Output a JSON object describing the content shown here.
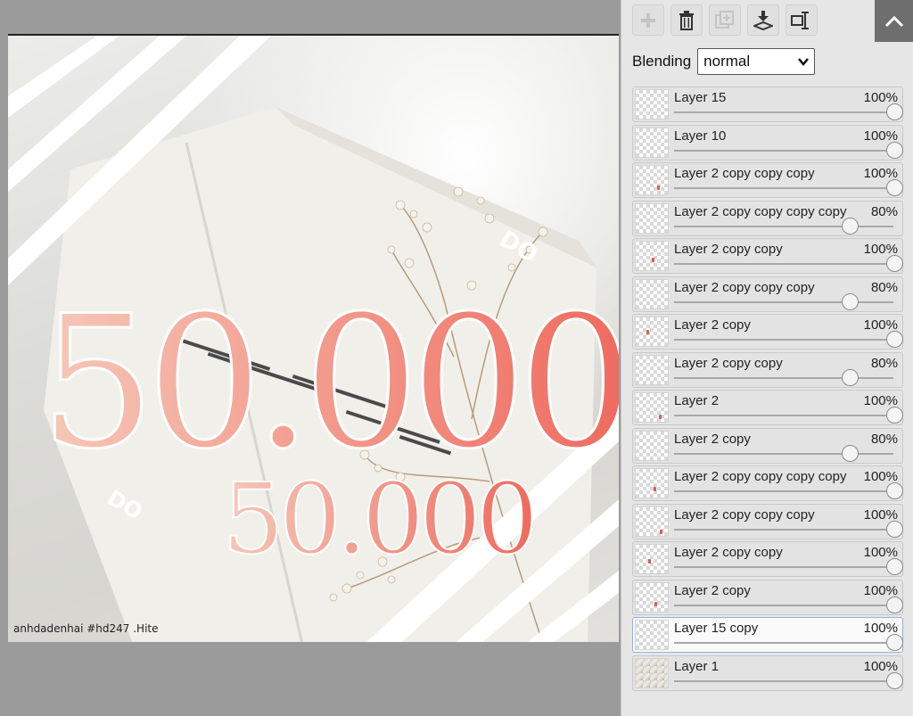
{
  "canvas": {
    "watermark": "anhdadenhai #hd247 .Hite",
    "big_number": "50.000",
    "small_number": "50.000",
    "sticker_text": "DO"
  },
  "toolbar": {
    "buttons": [
      {
        "name": "add-layer-button",
        "icon": "plus-icon"
      },
      {
        "name": "delete-layer-button",
        "icon": "trash-icon"
      },
      {
        "name": "duplicate-layer-button",
        "icon": "duplicate-icon"
      },
      {
        "name": "merge-down-button",
        "icon": "merge-down-icon"
      },
      {
        "name": "layer-properties-button",
        "icon": "properties-icon"
      }
    ],
    "collapse_icon": "chevron-up-icon"
  },
  "blending": {
    "label": "Blending",
    "value": "normal"
  },
  "layers": [
    {
      "name": "Layer 15",
      "opacity": "100%",
      "opacity_value": 1.0,
      "thumb": "blank"
    },
    {
      "name": "Layer 10",
      "opacity": "100%",
      "opacity_value": 1.0,
      "thumb": "blank"
    },
    {
      "name": "Layer 2 copy copy copy",
      "opacity": "100%",
      "opacity_value": 1.0,
      "thumb": "dot"
    },
    {
      "name": "Layer 2 copy copy copy copy",
      "opacity": "80%",
      "opacity_value": 0.8,
      "thumb": "blank"
    },
    {
      "name": "Layer 2 copy copy",
      "opacity": "100%",
      "opacity_value": 1.0,
      "thumb": "dot"
    },
    {
      "name": "Layer 2 copy copy copy",
      "opacity": "80%",
      "opacity_value": 0.8,
      "thumb": "blank"
    },
    {
      "name": "Layer 2 copy",
      "opacity": "100%",
      "opacity_value": 1.0,
      "thumb": "dot"
    },
    {
      "name": "Layer 2 copy copy",
      "opacity": "80%",
      "opacity_value": 0.8,
      "thumb": "blank"
    },
    {
      "name": "Layer 2",
      "opacity": "100%",
      "opacity_value": 1.0,
      "thumb": "dot"
    },
    {
      "name": "Layer 2 copy",
      "opacity": "80%",
      "opacity_value": 0.8,
      "thumb": "blank"
    },
    {
      "name": "Layer 2 copy copy copy copy",
      "opacity": "100%",
      "opacity_value": 1.0,
      "thumb": "dot"
    },
    {
      "name": "Layer 2 copy copy copy",
      "opacity": "100%",
      "opacity_value": 1.0,
      "thumb": "dot"
    },
    {
      "name": "Layer 2 copy copy",
      "opacity": "100%",
      "opacity_value": 1.0,
      "thumb": "dot"
    },
    {
      "name": "Layer 2 copy",
      "opacity": "100%",
      "opacity_value": 1.0,
      "thumb": "dot"
    },
    {
      "name": "Layer 15 copy",
      "opacity": "100%",
      "opacity_value": 1.0,
      "thumb": "blank",
      "selected": true
    },
    {
      "name": "Layer 1",
      "opacity": "100%",
      "opacity_value": 1.0,
      "thumb": "photo"
    }
  ]
}
